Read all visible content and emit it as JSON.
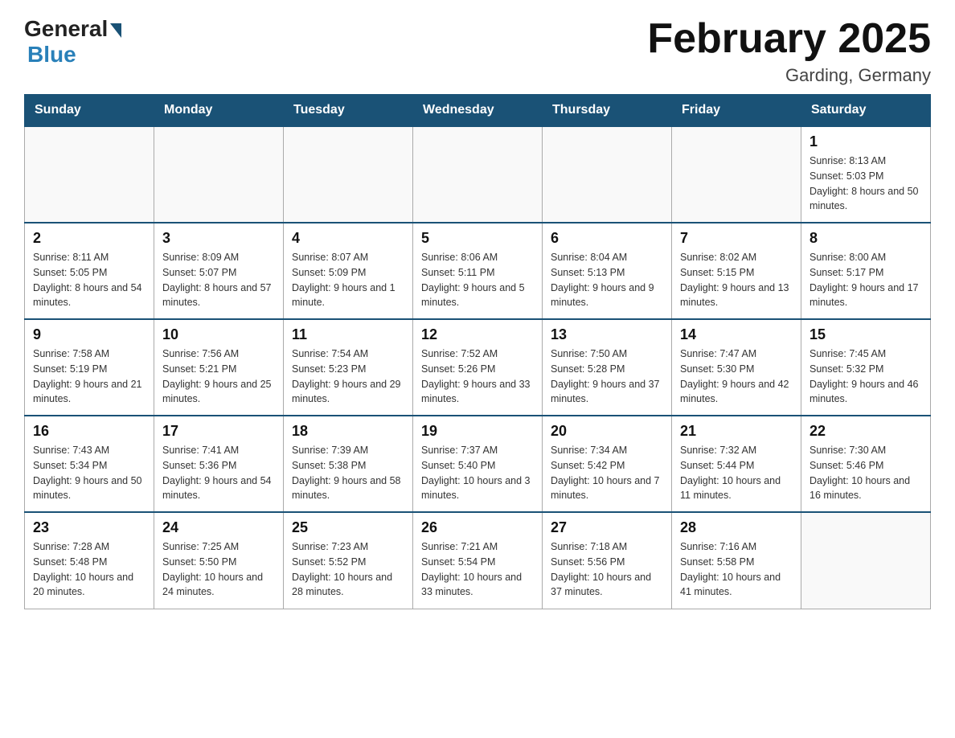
{
  "logo": {
    "general": "General",
    "blue": "Blue"
  },
  "header": {
    "title": "February 2025",
    "subtitle": "Garding, Germany"
  },
  "weekdays": [
    "Sunday",
    "Monday",
    "Tuesday",
    "Wednesday",
    "Thursday",
    "Friday",
    "Saturday"
  ],
  "weeks": [
    [
      {
        "day": "",
        "info": ""
      },
      {
        "day": "",
        "info": ""
      },
      {
        "day": "",
        "info": ""
      },
      {
        "day": "",
        "info": ""
      },
      {
        "day": "",
        "info": ""
      },
      {
        "day": "",
        "info": ""
      },
      {
        "day": "1",
        "info": "Sunrise: 8:13 AM\nSunset: 5:03 PM\nDaylight: 8 hours and 50 minutes."
      }
    ],
    [
      {
        "day": "2",
        "info": "Sunrise: 8:11 AM\nSunset: 5:05 PM\nDaylight: 8 hours and 54 minutes."
      },
      {
        "day": "3",
        "info": "Sunrise: 8:09 AM\nSunset: 5:07 PM\nDaylight: 8 hours and 57 minutes."
      },
      {
        "day": "4",
        "info": "Sunrise: 8:07 AM\nSunset: 5:09 PM\nDaylight: 9 hours and 1 minute."
      },
      {
        "day": "5",
        "info": "Sunrise: 8:06 AM\nSunset: 5:11 PM\nDaylight: 9 hours and 5 minutes."
      },
      {
        "day": "6",
        "info": "Sunrise: 8:04 AM\nSunset: 5:13 PM\nDaylight: 9 hours and 9 minutes."
      },
      {
        "day": "7",
        "info": "Sunrise: 8:02 AM\nSunset: 5:15 PM\nDaylight: 9 hours and 13 minutes."
      },
      {
        "day": "8",
        "info": "Sunrise: 8:00 AM\nSunset: 5:17 PM\nDaylight: 9 hours and 17 minutes."
      }
    ],
    [
      {
        "day": "9",
        "info": "Sunrise: 7:58 AM\nSunset: 5:19 PM\nDaylight: 9 hours and 21 minutes."
      },
      {
        "day": "10",
        "info": "Sunrise: 7:56 AM\nSunset: 5:21 PM\nDaylight: 9 hours and 25 minutes."
      },
      {
        "day": "11",
        "info": "Sunrise: 7:54 AM\nSunset: 5:23 PM\nDaylight: 9 hours and 29 minutes."
      },
      {
        "day": "12",
        "info": "Sunrise: 7:52 AM\nSunset: 5:26 PM\nDaylight: 9 hours and 33 minutes."
      },
      {
        "day": "13",
        "info": "Sunrise: 7:50 AM\nSunset: 5:28 PM\nDaylight: 9 hours and 37 minutes."
      },
      {
        "day": "14",
        "info": "Sunrise: 7:47 AM\nSunset: 5:30 PM\nDaylight: 9 hours and 42 minutes."
      },
      {
        "day": "15",
        "info": "Sunrise: 7:45 AM\nSunset: 5:32 PM\nDaylight: 9 hours and 46 minutes."
      }
    ],
    [
      {
        "day": "16",
        "info": "Sunrise: 7:43 AM\nSunset: 5:34 PM\nDaylight: 9 hours and 50 minutes."
      },
      {
        "day": "17",
        "info": "Sunrise: 7:41 AM\nSunset: 5:36 PM\nDaylight: 9 hours and 54 minutes."
      },
      {
        "day": "18",
        "info": "Sunrise: 7:39 AM\nSunset: 5:38 PM\nDaylight: 9 hours and 58 minutes."
      },
      {
        "day": "19",
        "info": "Sunrise: 7:37 AM\nSunset: 5:40 PM\nDaylight: 10 hours and 3 minutes."
      },
      {
        "day": "20",
        "info": "Sunrise: 7:34 AM\nSunset: 5:42 PM\nDaylight: 10 hours and 7 minutes."
      },
      {
        "day": "21",
        "info": "Sunrise: 7:32 AM\nSunset: 5:44 PM\nDaylight: 10 hours and 11 minutes."
      },
      {
        "day": "22",
        "info": "Sunrise: 7:30 AM\nSunset: 5:46 PM\nDaylight: 10 hours and 16 minutes."
      }
    ],
    [
      {
        "day": "23",
        "info": "Sunrise: 7:28 AM\nSunset: 5:48 PM\nDaylight: 10 hours and 20 minutes."
      },
      {
        "day": "24",
        "info": "Sunrise: 7:25 AM\nSunset: 5:50 PM\nDaylight: 10 hours and 24 minutes."
      },
      {
        "day": "25",
        "info": "Sunrise: 7:23 AM\nSunset: 5:52 PM\nDaylight: 10 hours and 28 minutes."
      },
      {
        "day": "26",
        "info": "Sunrise: 7:21 AM\nSunset: 5:54 PM\nDaylight: 10 hours and 33 minutes."
      },
      {
        "day": "27",
        "info": "Sunrise: 7:18 AM\nSunset: 5:56 PM\nDaylight: 10 hours and 37 minutes."
      },
      {
        "day": "28",
        "info": "Sunrise: 7:16 AM\nSunset: 5:58 PM\nDaylight: 10 hours and 41 minutes."
      },
      {
        "day": "",
        "info": ""
      }
    ]
  ]
}
